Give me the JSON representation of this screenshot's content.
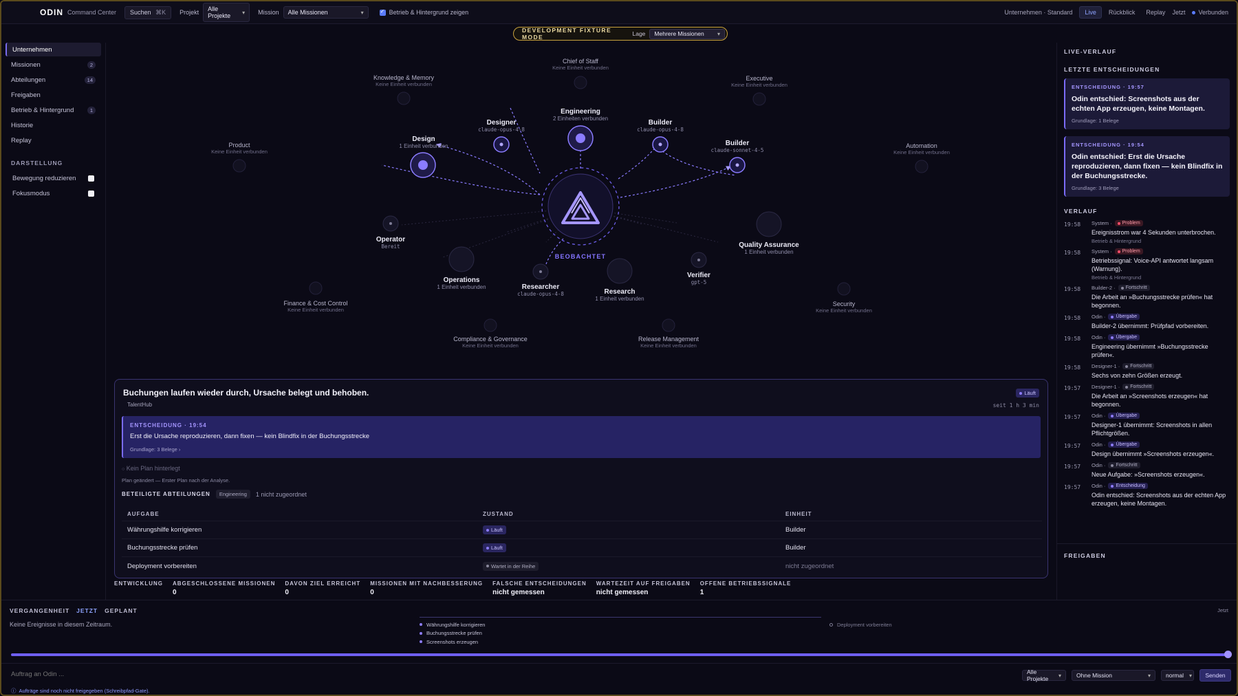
{
  "topbar": {
    "brand": "ODIN",
    "brand_sub": "Command Center",
    "search_label": "Suchen",
    "search_shortcut": "⌘K",
    "project_label": "Projekt",
    "project_value": "Alle Projekte",
    "mission_label": "Mission",
    "mission_value": "Alle Missionen",
    "background_label": "Betrieb & Hintergrund zeigen",
    "background_checked": true,
    "company_label": "Unternehmen · Standard",
    "live": "Live",
    "back": "Rückblick",
    "replay": "Replay",
    "now": "Jetzt",
    "connected": "Verbunden"
  },
  "fixture": {
    "title": "DEVELOPMENT FIXTURE MODE",
    "lage_label": "Lage",
    "lage_value": "Mehrere Missionen"
  },
  "sidebar": {
    "items": [
      {
        "label": "Unternehmen",
        "badge": "",
        "active": true
      },
      {
        "label": "Missionen",
        "badge": "2"
      },
      {
        "label": "Abteilungen",
        "badge": "14"
      },
      {
        "label": "Freigaben",
        "badge": ""
      },
      {
        "label": "Betrieb & Hintergrund",
        "badge": "1"
      },
      {
        "label": "Historie",
        "badge": ""
      },
      {
        "label": "Replay",
        "badge": ""
      }
    ],
    "display_heading": "DARSTELLUNG",
    "toggles": [
      {
        "label": "Bewegung reduzieren",
        "checked": false
      },
      {
        "label": "Fokusmodus",
        "checked": false
      }
    ]
  },
  "graph": {
    "center_label": "BEOBACHTET",
    "nodes": [
      {
        "name": "Chief of Staff",
        "sub": "Keine Einheit verbunden",
        "dim": true
      },
      {
        "name": "Knowledge & Memory",
        "sub": "Keine Einheit verbunden",
        "dim": true
      },
      {
        "name": "Executive",
        "sub": "Keine Einheit verbunden",
        "dim": true
      },
      {
        "name": "Product",
        "sub": "Keine Einheit verbunden",
        "dim": true
      },
      {
        "name": "Automation",
        "sub": "Keine Einheit verbunden",
        "dim": true
      },
      {
        "name": "Engineering",
        "sub": "2 Einheiten verbunden"
      },
      {
        "name": "Designer",
        "sub": "claude-opus-4-8",
        "mono": true
      },
      {
        "name": "Builder",
        "sub": "claude-opus-4-8",
        "mono": true
      },
      {
        "name": "Builder",
        "sub": "claude-sonnet-4-5",
        "mono": true
      },
      {
        "name": "Design",
        "sub": "1 Einheit verbunden"
      },
      {
        "name": "Operator",
        "sub": "Bereit",
        "mono": true
      },
      {
        "name": "Quality Assurance",
        "sub": "1 Einheit verbunden"
      },
      {
        "name": "Operations",
        "sub": "1 Einheit verbunden"
      },
      {
        "name": "Researcher",
        "sub": "claude-opus-4-8",
        "mono": true
      },
      {
        "name": "Research",
        "sub": "1 Einheit verbunden"
      },
      {
        "name": "Verifier",
        "sub": "gpt-5",
        "mono": true
      },
      {
        "name": "Finance & Cost Control",
        "sub": "Keine Einheit verbunden",
        "dim": true
      },
      {
        "name": "Security",
        "sub": "Keine Einheit verbunden",
        "dim": true
      },
      {
        "name": "Compliance & Governance",
        "sub": "Keine Einheit verbunden",
        "dim": true
      },
      {
        "name": "Release Management",
        "sub": "Keine Einheit verbunden",
        "dim": true
      }
    ]
  },
  "mission": {
    "title": "Buchungen laufen wieder durch, Ursache belegt und behoben.",
    "status": "Läuft",
    "project": "TalentHub",
    "since": "seit 1 h 3 min",
    "decision": {
      "heading": "ENTSCHEIDUNG · 19:54",
      "text": "Erst die Ursache reproduzieren, dann fixen — kein Blindfix in der Buchungsstrecke",
      "basis": "Grundlage: 3 Belege ›"
    },
    "no_plan": "Kein Plan hinterlegt",
    "plan_changed": "Plan geändert — Erster Plan nach der Analyse.",
    "departments_heading": "BETEILIGTE ABTEILUNGEN",
    "department_chip": "Engineering",
    "unassigned": "1 nicht zugeordnet",
    "table_headers": {
      "task": "AUFGABE",
      "state": "ZUSTAND",
      "unit": "EINHEIT"
    },
    "tasks": [
      {
        "task": "Währungshilfe korrigieren",
        "state": "Läuft",
        "kind": "run",
        "unit": "Builder"
      },
      {
        "task": "Buchungsstrecke prüfen",
        "state": "Läuft",
        "kind": "run",
        "unit": "Builder"
      },
      {
        "task": "Deployment vorbereiten",
        "state": "Wartet in der Reihe",
        "kind": "wait",
        "unit": "nicht zugeordnet"
      }
    ]
  },
  "metrics": [
    {
      "label": "ENTWICKLUNG",
      "value": ""
    },
    {
      "label": "ABGESCHLOSSENE MISSIONEN",
      "value": "0"
    },
    {
      "label": "DAVON ZIEL ERREICHT",
      "value": "0"
    },
    {
      "label": "MISSIONEN MIT NACHBESSERUNG",
      "value": "0"
    },
    {
      "label": "FALSCHE ENTSCHEIDUNGEN",
      "value": "nicht gemessen"
    },
    {
      "label": "WARTEZEIT AUF FREIGABEN",
      "value": "nicht gemessen"
    },
    {
      "label": "OFFENE BETRIEBSSIGNALE",
      "value": "1"
    }
  ],
  "right": {
    "live_heading": "LIVE-VERLAUF",
    "decisions_heading": "LETZTE ENTSCHEIDUNGEN",
    "decisions": [
      {
        "heading": "ENTSCHEIDUNG · 19:57",
        "text": "Odin entschied: Screenshots aus der echten App erzeugen, keine Montagen.",
        "basis": "Grundlage: 1 Belege"
      },
      {
        "heading": "ENTSCHEIDUNG · 19:54",
        "text": "Odin entschied: Erst die Ursache reproduzieren, dann fixen — kein Blindfix in der Buchungsstrecke.",
        "basis": "Grundlage: 3 Belege"
      }
    ],
    "history_heading": "VERLAUF",
    "events": [
      {
        "time": "19:58",
        "source": "System ·",
        "tag": "Problem",
        "kind": "problem",
        "text": "Ereignisstrom war 4 Sekunden unterbrochen.",
        "ctx": "Betrieb & Hintergrund"
      },
      {
        "time": "19:58",
        "source": "System ·",
        "tag": "Problem",
        "kind": "problem",
        "text": "Betriebssignal: Voice-API antwortet langsam (Warnung).",
        "ctx": "Betrieb & Hintergrund"
      },
      {
        "time": "19:58",
        "source": "Builder-2 ·",
        "tag": "Fortschritt",
        "kind": "progress",
        "text": "Die Arbeit an »Buchungsstrecke prüfen« hat begonnen.",
        "ctx": ""
      },
      {
        "time": "19:58",
        "source": "Odin ·",
        "tag": "Übergabe",
        "kind": "handover",
        "text": "Builder-2 übernimmt: Prüfpfad vorbereiten.",
        "ctx": ""
      },
      {
        "time": "19:58",
        "source": "Odin ·",
        "tag": "Übergabe",
        "kind": "handover",
        "text": "Engineering übernimmt »Buchungsstrecke prüfen«.",
        "ctx": ""
      },
      {
        "time": "19:58",
        "source": "Designer-1 ·",
        "tag": "Fortschritt",
        "kind": "progress",
        "text": "Sechs von zehn Größen erzeugt.",
        "ctx": ""
      },
      {
        "time": "19:57",
        "source": "Designer-1 ·",
        "tag": "Fortschritt",
        "kind": "progress",
        "text": "Die Arbeit an »Screenshots erzeugen« hat begonnen.",
        "ctx": ""
      },
      {
        "time": "19:57",
        "source": "Odin ·",
        "tag": "Übergabe",
        "kind": "handover",
        "text": "Designer-1 übernimmt: Screenshots in allen Pflichtgrößen.",
        "ctx": ""
      },
      {
        "time": "19:57",
        "source": "Odin ·",
        "tag": "Übergabe",
        "kind": "handover",
        "text": "Design übernimmt »Screenshots erzeugen«.",
        "ctx": ""
      },
      {
        "time": "19:57",
        "source": "Odin ·",
        "tag": "Fortschritt",
        "kind": "progress",
        "text": "Neue Aufgabe: »Screenshots erzeugen«.",
        "ctx": ""
      },
      {
        "time": "19:57",
        "source": "Odin ·",
        "tag": "Entscheidung",
        "kind": "decision",
        "text": "Odin entschied: Screenshots aus der echten App erzeugen, keine Montagen.",
        "ctx": ""
      }
    ],
    "approvals_heading": "FREIGABEN"
  },
  "timeline": {
    "tabs": [
      "VERGANGENHEIT",
      "JETZT",
      "GEPLANT"
    ],
    "active_tab": "JETZT",
    "now_label": "Jetzt",
    "empty": "Keine Ereignisse in diesem Zeitraum.",
    "current": [
      "Währungshilfe korrigieren",
      "Buchungsstrecke prüfen",
      "Screenshots erzeugen"
    ],
    "planned": [
      "Deployment vorbereiten"
    ],
    "position": 1.0
  },
  "composer": {
    "placeholder": "Auftrag an Odin ...",
    "project": "Alle Projekte",
    "mission": "Ohne Mission",
    "priority": "normal",
    "send": "Senden",
    "gate_note": "Aufträge sind noch nicht freigegeben (Schreibpfad-Gate)."
  },
  "colors": {
    "accent": "#7b6cff",
    "fixture": "#c9a23d",
    "problem": "#ff4d6a",
    "live": "#5b7cff"
  }
}
